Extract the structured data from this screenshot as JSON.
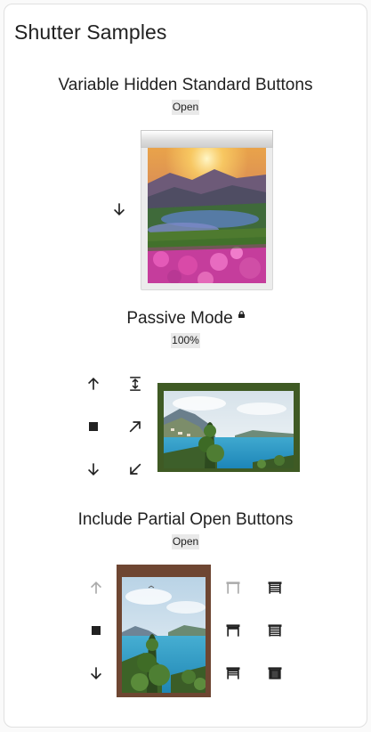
{
  "card": {
    "title": "Shutter Samples"
  },
  "sections": [
    {
      "title": "Variable Hidden Standard Buttons",
      "state": "Open",
      "buttons": [
        "arrow-down-icon"
      ]
    },
    {
      "title": "Passive Mode",
      "state": "100%",
      "buttons": [
        "arrow-up-icon",
        "open-full-icon",
        "stop-icon",
        "arrow-up-right-icon",
        "arrow-down-icon",
        "arrow-down-left-icon"
      ]
    },
    {
      "title": "Include Partial Open Buttons",
      "state": "Open",
      "buttons": [
        "arrow-up-icon",
        "stop-icon",
        "arrow-down-icon",
        "shutter-open-icon",
        "shutter-partial-25-icon",
        "shutter-partial-50-icon",
        "shutter-partial-75-icon",
        "shutter-partial-90-icon",
        "shutter-closed-icon"
      ]
    }
  ],
  "colors": {
    "text": "#212121",
    "state_bg": "#e9e9e9",
    "frame_white": "#ececec",
    "frame_green": "#3f5a24",
    "frame_brown": "#6e4632"
  }
}
